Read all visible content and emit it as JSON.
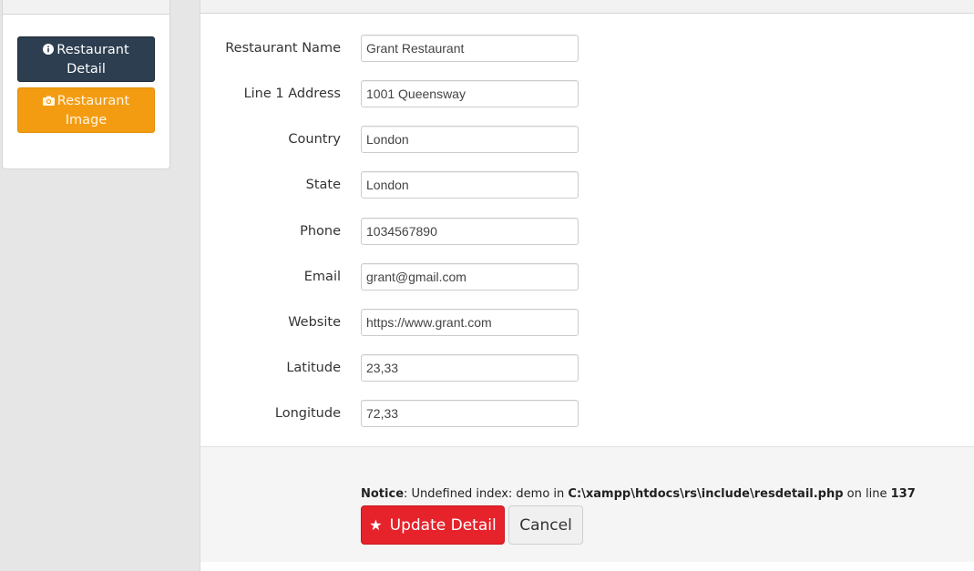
{
  "sidebar": {
    "detail_button": {
      "label": "Restaurant Detail",
      "icon": "info-circle-icon"
    },
    "image_button": {
      "label": "Restaurant Image",
      "icon": "camera-icon"
    }
  },
  "form": {
    "fields": [
      {
        "label": "Restaurant Name",
        "value": "Grant Restaurant"
      },
      {
        "label": "Line 1 Address",
        "value": "1001 Queensway"
      },
      {
        "label": "Country",
        "value": "London"
      },
      {
        "label": "State",
        "value": "London"
      },
      {
        "label": "Phone",
        "value": "1034567890"
      },
      {
        "label": "Email",
        "value": "grant@gmail.com"
      },
      {
        "label": "Website",
        "value": "https://www.grant.com"
      },
      {
        "label": "Latitude",
        "value": "23,33"
      },
      {
        "label": "Longitude",
        "value": "72,33"
      }
    ]
  },
  "notice": {
    "prefix": "Notice",
    "message": ": Undefined index: demo in ",
    "path": "C:\\xampp\\htdocs\\rs\\include\\resdetail.php",
    "line_text": " on line ",
    "line": "137"
  },
  "actions": {
    "update_label": "Update Detail",
    "cancel_label": "Cancel"
  },
  "colors": {
    "detail_button": "#2c3e50",
    "image_button": "#f39c12",
    "update_button": "#e6222b"
  }
}
